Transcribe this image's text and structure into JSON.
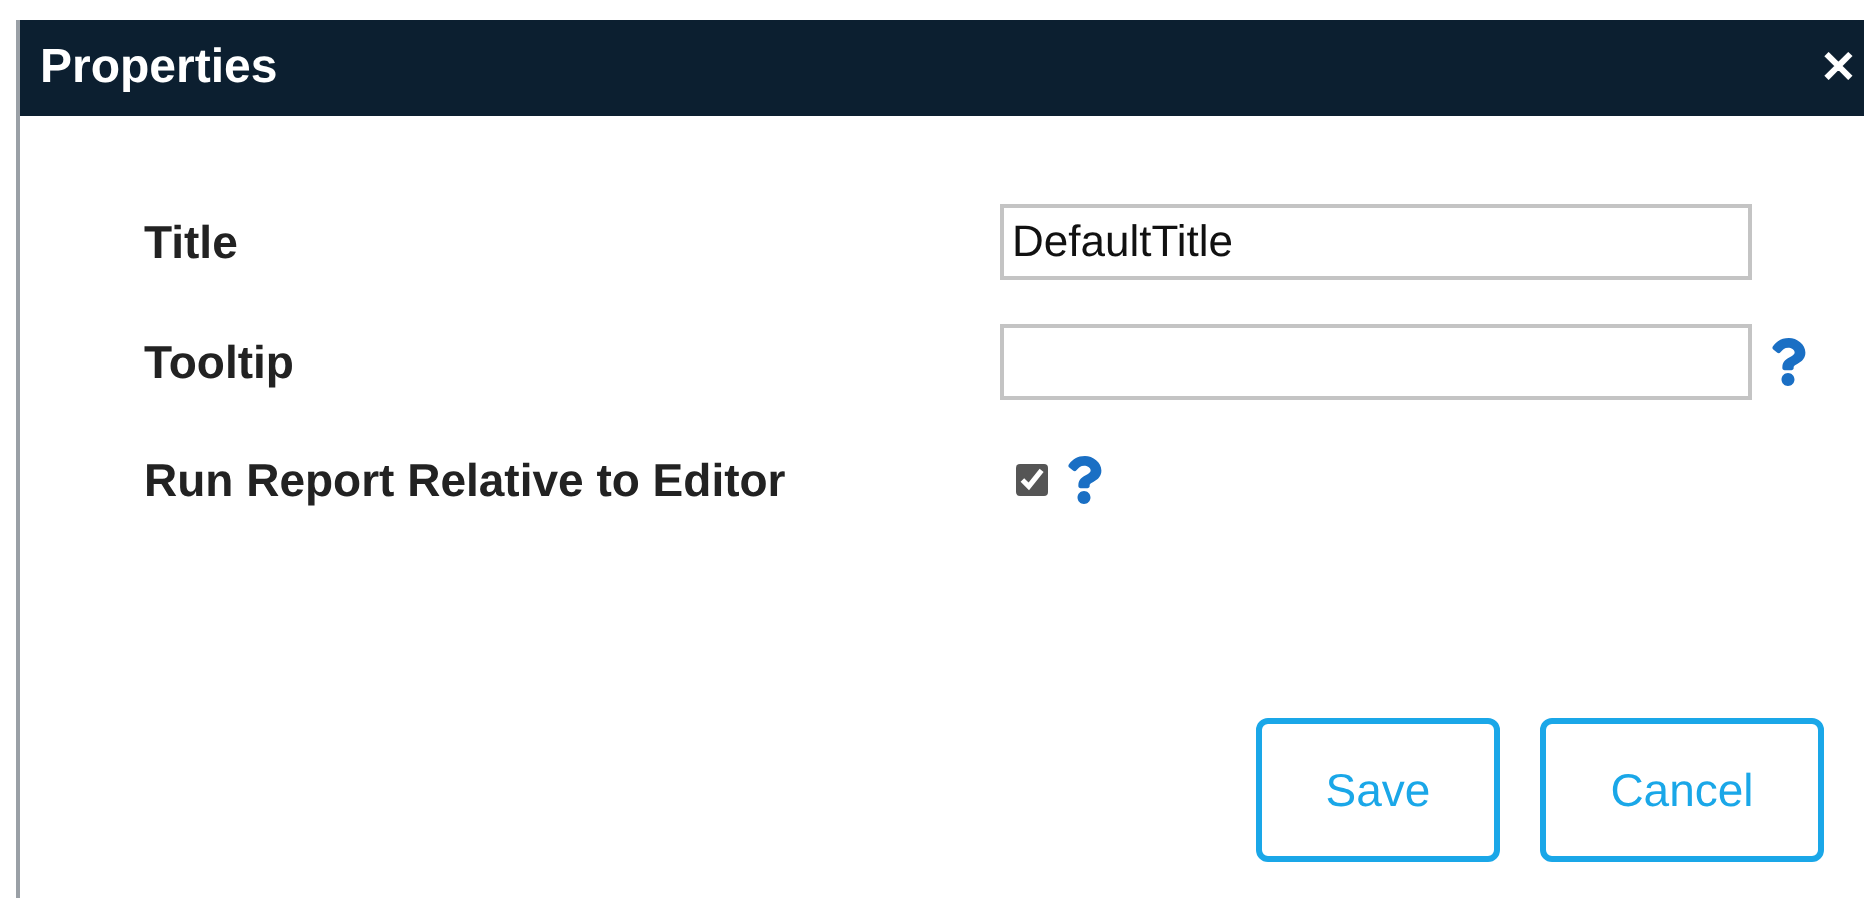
{
  "window": {
    "title": "Properties",
    "close": "✕"
  },
  "fields": [
    {
      "kind": "text",
      "label": "Title",
      "value": "DefaultTitle",
      "help": false
    },
    {
      "kind": "text",
      "label": "Tooltip",
      "help": true
    },
    {
      "kind": "checkbox",
      "label": "Run Report Relative to Editor",
      "checked": true,
      "help": true
    }
  ],
  "buttons": [
    "Save",
    "Cancel"
  ]
}
